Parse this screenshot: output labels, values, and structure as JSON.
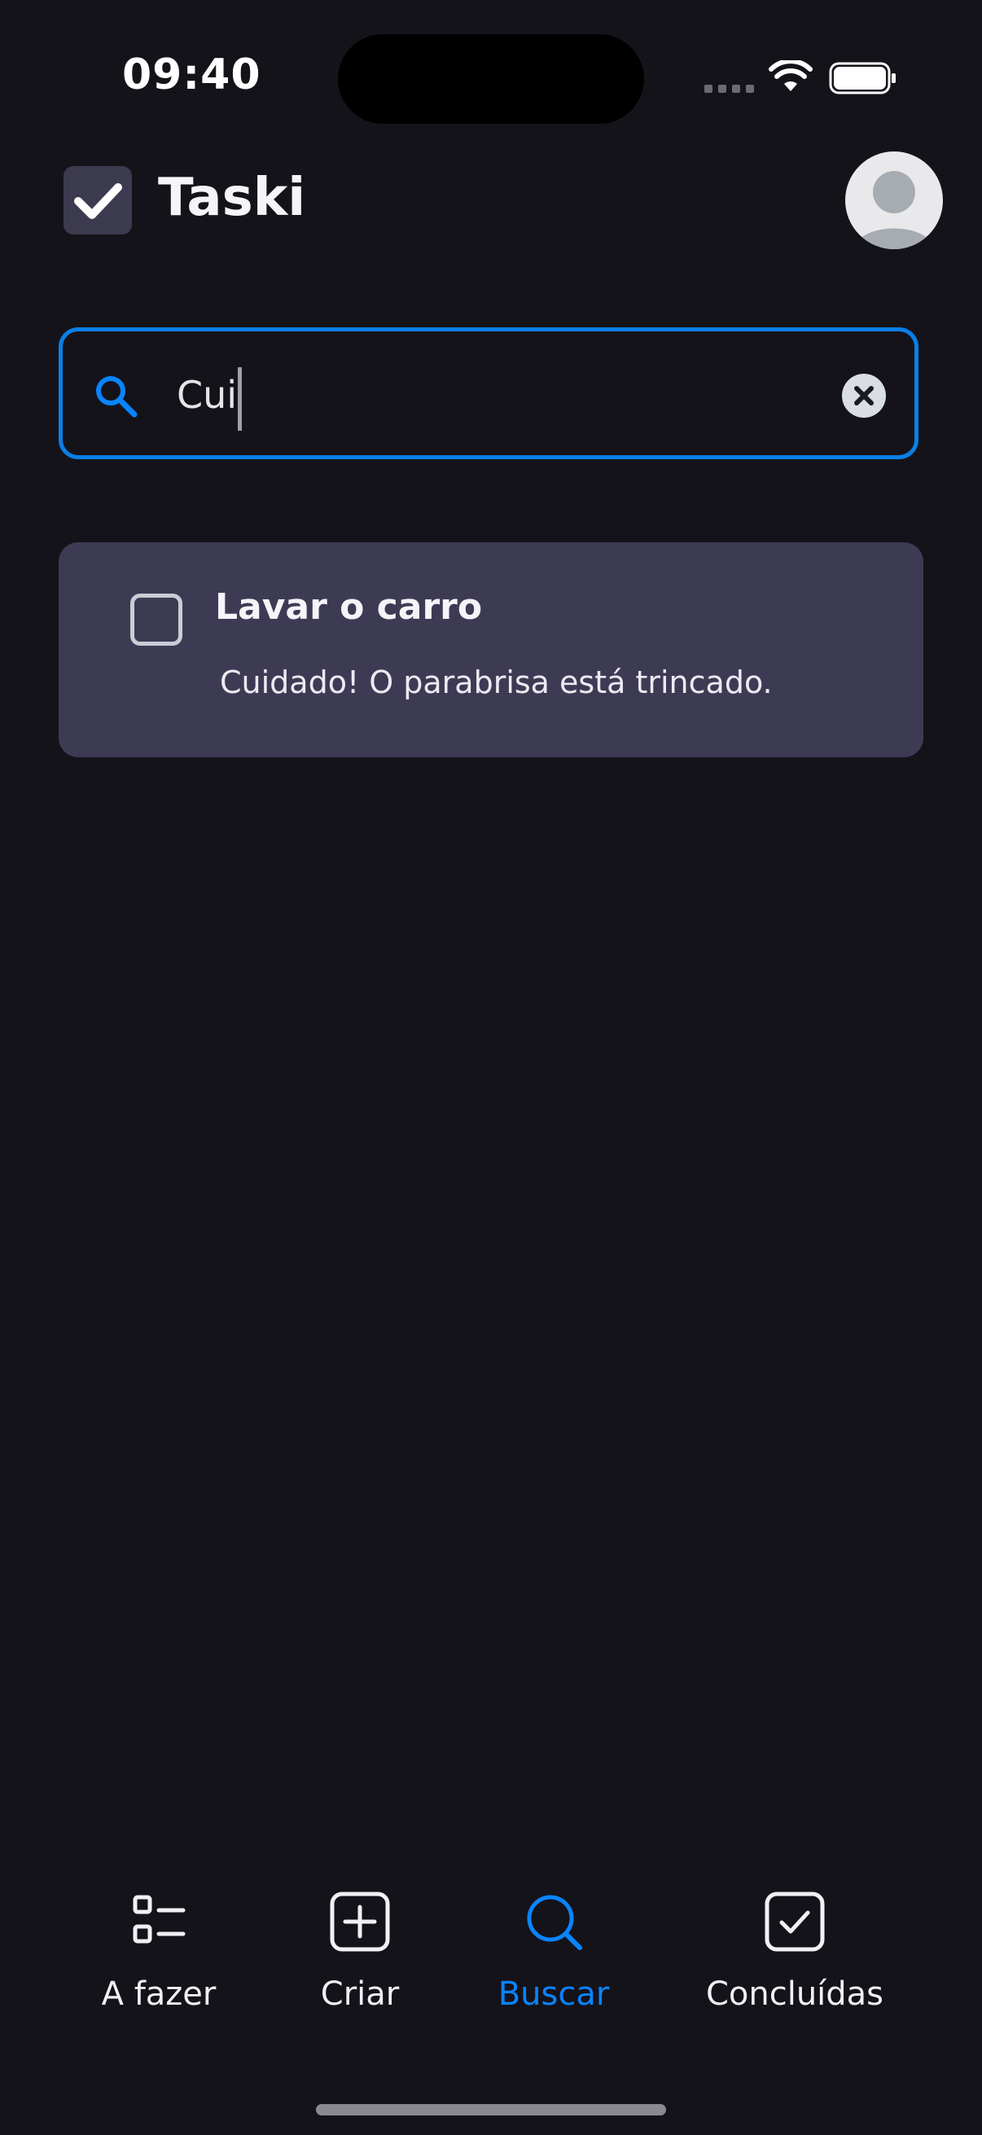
{
  "status_bar": {
    "time": "09:40",
    "icons": [
      "cellular-signal-icon",
      "wifi-icon",
      "battery-icon"
    ]
  },
  "header": {
    "app_name": "Taski",
    "logo_icon": "checkbox-check-icon",
    "avatar_icon": "user-avatar-icon"
  },
  "search": {
    "value": "Cui",
    "icon": "search-icon",
    "clear_icon": "clear-circle-icon",
    "border_color": "#0a7fe6"
  },
  "results": [
    {
      "title": "Lavar o carro",
      "note": "Cuidado! O parabrisa está trincado.",
      "checked": false
    }
  ],
  "bottom_nav": {
    "active": "search",
    "items": [
      {
        "id": "todo",
        "label": "A fazer",
        "icon": "list-icon"
      },
      {
        "id": "create",
        "label": "Criar",
        "icon": "plus-square-icon"
      },
      {
        "id": "search",
        "label": "Buscar",
        "icon": "search-icon"
      },
      {
        "id": "done",
        "label": "Concluídas",
        "icon": "check-square-icon"
      }
    ]
  },
  "colors": {
    "background": "#15131a",
    "card": "#3d3b54",
    "accent": "#0a84ff",
    "text": "#f3f2f7"
  }
}
